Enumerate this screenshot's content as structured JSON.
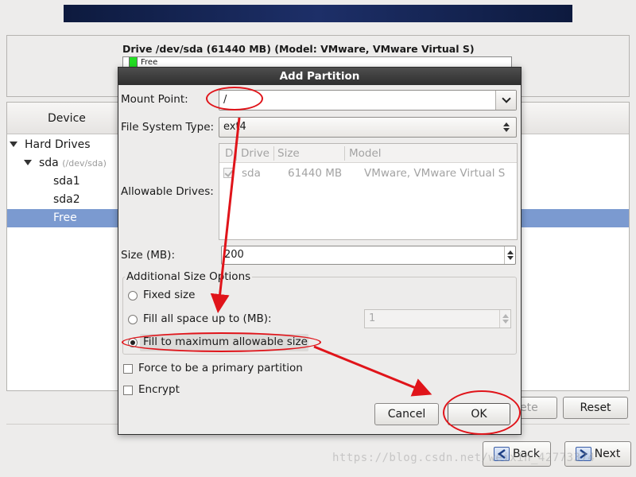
{
  "background": {
    "drive_title": "Drive /dev/sda (61440 MB) (Model: VMware, VMware Virtual S)",
    "drive_bar_free": "Free",
    "device_header": "Device",
    "tree": {
      "hard_drives": "Hard Drives",
      "sda": "sda",
      "sda_path": "(/dev/sda)",
      "sda1": "sda1",
      "sda2": "sda2",
      "free": "Free"
    },
    "buttons": {
      "delete_partial": "ete",
      "reset": "Reset",
      "back": "Back",
      "next": "Next"
    }
  },
  "dialog": {
    "title": "Add Partition",
    "mount_point_label": "Mount Point:",
    "mount_point_value": "/",
    "fs_type_label": "File System Type:",
    "fs_type_value": "ext4",
    "allowable_drives_label": "Allowable Drives:",
    "drives_table": {
      "headers": [
        "D",
        "Drive",
        "Size",
        "Model"
      ],
      "rows": [
        {
          "checked": true,
          "drive": "sda",
          "size": "61440 MB",
          "model": "VMware, VMware Virtual S"
        }
      ]
    },
    "size_label": "Size (MB):",
    "size_value": "200",
    "size_options_title": "Additional Size Options",
    "opt_fixed": "Fixed size",
    "opt_fill_up_to": "Fill all space up to (MB):",
    "fill_up_to_value": "1",
    "opt_fill_max": "Fill to maximum allowable size",
    "selected_option": "fill_max",
    "primary_label": "Force to be a primary partition",
    "encrypt_label": "Encrypt",
    "cancel": "Cancel",
    "ok": "OK"
  },
  "watermark": "https://blog.csdn.net/weixin_42773374",
  "colors": {
    "annotation": "#e0141a",
    "selection": "#7b9ad0",
    "dialog_title": "#2f2f2f"
  }
}
